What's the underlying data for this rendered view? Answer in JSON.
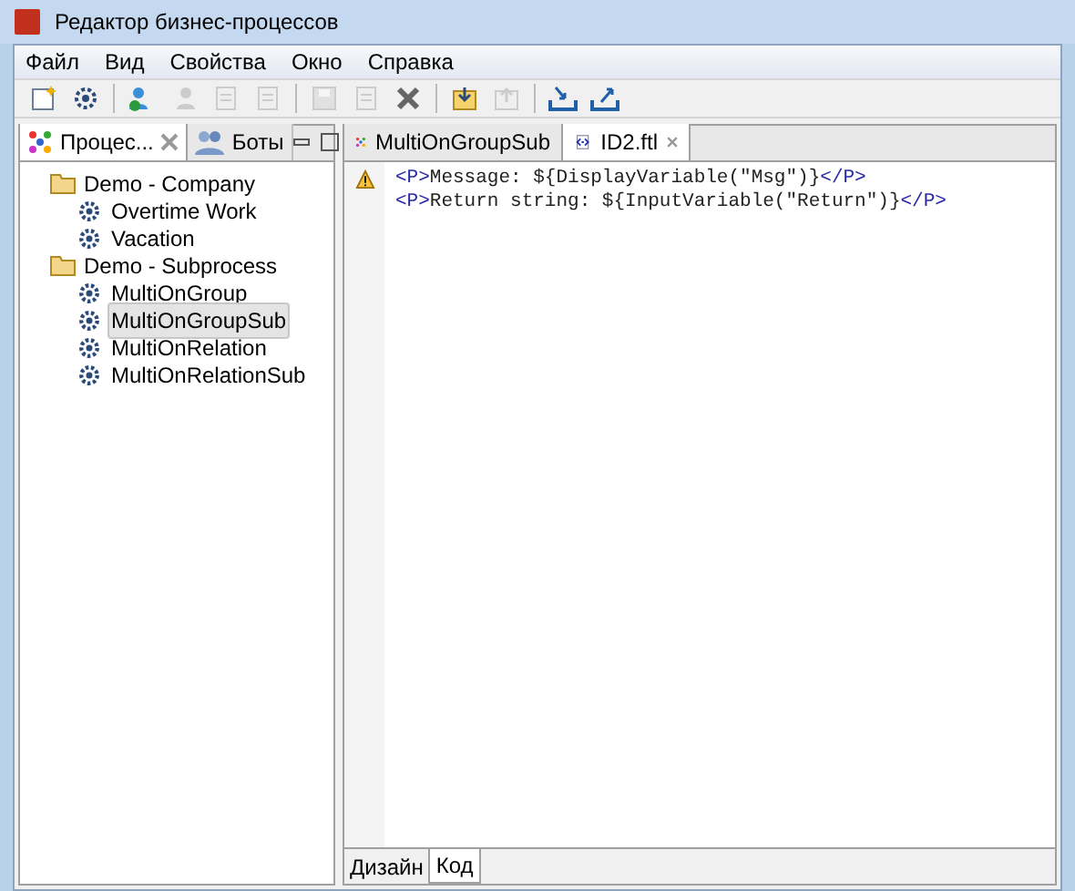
{
  "window": {
    "title": "Редактор бизнес-процессов"
  },
  "menu": [
    "Файл",
    "Вид",
    "Свойства",
    "Окно",
    "Справка"
  ],
  "toolbar": [
    [
      {
        "kind": "new",
        "disabled": false
      },
      {
        "kind": "gear",
        "disabled": false
      }
    ],
    [
      {
        "kind": "people",
        "disabled": false
      },
      {
        "kind": "person",
        "disabled": true
      },
      {
        "kind": "doc",
        "disabled": true
      },
      {
        "kind": "doc",
        "disabled": true
      }
    ],
    [
      {
        "kind": "save",
        "disabled": true
      },
      {
        "kind": "doc",
        "disabled": true
      },
      {
        "kind": "delete",
        "disabled": false
      }
    ],
    [
      {
        "kind": "import",
        "disabled": false
      },
      {
        "kind": "export",
        "disabled": true
      }
    ],
    [
      {
        "kind": "tray-in",
        "disabled": false
      },
      {
        "kind": "tray-out",
        "disabled": false
      }
    ]
  ],
  "left_panel": {
    "tabs": [
      {
        "label": "Процес...",
        "selected": true,
        "kind": "process"
      },
      {
        "label": "Боты",
        "selected": false,
        "kind": "bots"
      }
    ],
    "tree": [
      {
        "label": "Demo - Company",
        "kind": "folder",
        "children": [
          {
            "label": "Overtime Work",
            "kind": "process",
            "selected": false
          },
          {
            "label": "Vacation",
            "kind": "process",
            "selected": false
          }
        ]
      },
      {
        "label": "Demo - Subprocess",
        "kind": "folder",
        "children": [
          {
            "label": "MultiOnGroup",
            "kind": "process",
            "selected": false
          },
          {
            "label": "MultiOnGroupSub",
            "kind": "process",
            "selected": true
          },
          {
            "label": "MultiOnRelation",
            "kind": "process",
            "selected": false
          },
          {
            "label": "MultiOnRelationSub",
            "kind": "process",
            "selected": false
          }
        ]
      }
    ]
  },
  "editor": {
    "tabs": [
      {
        "label": "MultiOnGroupSub",
        "selected": false,
        "kind": "process"
      },
      {
        "label": "ID2.ftl",
        "selected": true,
        "kind": "html"
      }
    ],
    "lines": [
      {
        "warning": true,
        "segments": [
          {
            "kind": "tag",
            "text": "<P>"
          },
          {
            "kind": "text",
            "text": "Message: ${DisplayVariable(\"Msg\")}"
          },
          {
            "kind": "tag",
            "text": "</P>"
          }
        ]
      },
      {
        "warning": false,
        "segments": [
          {
            "kind": "tag",
            "text": "<P>"
          },
          {
            "kind": "text",
            "text": "Return string: ${InputVariable(\"Return\")}"
          },
          {
            "kind": "tag",
            "text": "</P>"
          }
        ]
      }
    ],
    "bottom_tabs": [
      {
        "label": "Дизайн",
        "selected": false
      },
      {
        "label": "Код",
        "selected": true
      }
    ]
  }
}
